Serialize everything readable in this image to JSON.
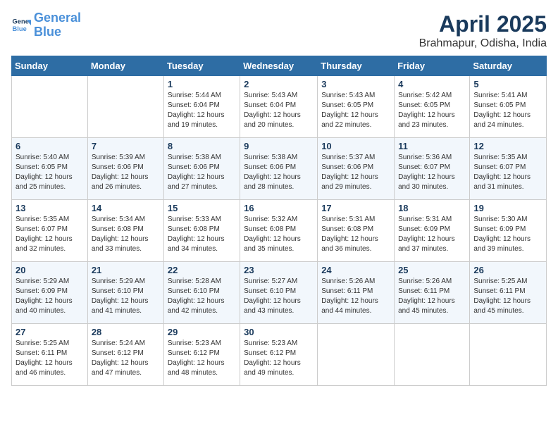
{
  "header": {
    "logo_line1": "General",
    "logo_line2": "Blue",
    "title": "April 2025",
    "subtitle": "Brahmapur, Odisha, India"
  },
  "weekdays": [
    "Sunday",
    "Monday",
    "Tuesday",
    "Wednesday",
    "Thursday",
    "Friday",
    "Saturday"
  ],
  "weeks": [
    [
      {
        "day": "",
        "sunrise": "",
        "sunset": "",
        "daylight": ""
      },
      {
        "day": "",
        "sunrise": "",
        "sunset": "",
        "daylight": ""
      },
      {
        "day": "1",
        "sunrise": "Sunrise: 5:44 AM",
        "sunset": "Sunset: 6:04 PM",
        "daylight": "Daylight: 12 hours and 19 minutes."
      },
      {
        "day": "2",
        "sunrise": "Sunrise: 5:43 AM",
        "sunset": "Sunset: 6:04 PM",
        "daylight": "Daylight: 12 hours and 20 minutes."
      },
      {
        "day": "3",
        "sunrise": "Sunrise: 5:43 AM",
        "sunset": "Sunset: 6:05 PM",
        "daylight": "Daylight: 12 hours and 22 minutes."
      },
      {
        "day": "4",
        "sunrise": "Sunrise: 5:42 AM",
        "sunset": "Sunset: 6:05 PM",
        "daylight": "Daylight: 12 hours and 23 minutes."
      },
      {
        "day": "5",
        "sunrise": "Sunrise: 5:41 AM",
        "sunset": "Sunset: 6:05 PM",
        "daylight": "Daylight: 12 hours and 24 minutes."
      }
    ],
    [
      {
        "day": "6",
        "sunrise": "Sunrise: 5:40 AM",
        "sunset": "Sunset: 6:05 PM",
        "daylight": "Daylight: 12 hours and 25 minutes."
      },
      {
        "day": "7",
        "sunrise": "Sunrise: 5:39 AM",
        "sunset": "Sunset: 6:06 PM",
        "daylight": "Daylight: 12 hours and 26 minutes."
      },
      {
        "day": "8",
        "sunrise": "Sunrise: 5:38 AM",
        "sunset": "Sunset: 6:06 PM",
        "daylight": "Daylight: 12 hours and 27 minutes."
      },
      {
        "day": "9",
        "sunrise": "Sunrise: 5:38 AM",
        "sunset": "Sunset: 6:06 PM",
        "daylight": "Daylight: 12 hours and 28 minutes."
      },
      {
        "day": "10",
        "sunrise": "Sunrise: 5:37 AM",
        "sunset": "Sunset: 6:06 PM",
        "daylight": "Daylight: 12 hours and 29 minutes."
      },
      {
        "day": "11",
        "sunrise": "Sunrise: 5:36 AM",
        "sunset": "Sunset: 6:07 PM",
        "daylight": "Daylight: 12 hours and 30 minutes."
      },
      {
        "day": "12",
        "sunrise": "Sunrise: 5:35 AM",
        "sunset": "Sunset: 6:07 PM",
        "daylight": "Daylight: 12 hours and 31 minutes."
      }
    ],
    [
      {
        "day": "13",
        "sunrise": "Sunrise: 5:35 AM",
        "sunset": "Sunset: 6:07 PM",
        "daylight": "Daylight: 12 hours and 32 minutes."
      },
      {
        "day": "14",
        "sunrise": "Sunrise: 5:34 AM",
        "sunset": "Sunset: 6:08 PM",
        "daylight": "Daylight: 12 hours and 33 minutes."
      },
      {
        "day": "15",
        "sunrise": "Sunrise: 5:33 AM",
        "sunset": "Sunset: 6:08 PM",
        "daylight": "Daylight: 12 hours and 34 minutes."
      },
      {
        "day": "16",
        "sunrise": "Sunrise: 5:32 AM",
        "sunset": "Sunset: 6:08 PM",
        "daylight": "Daylight: 12 hours and 35 minutes."
      },
      {
        "day": "17",
        "sunrise": "Sunrise: 5:31 AM",
        "sunset": "Sunset: 6:08 PM",
        "daylight": "Daylight: 12 hours and 36 minutes."
      },
      {
        "day": "18",
        "sunrise": "Sunrise: 5:31 AM",
        "sunset": "Sunset: 6:09 PM",
        "daylight": "Daylight: 12 hours and 37 minutes."
      },
      {
        "day": "19",
        "sunrise": "Sunrise: 5:30 AM",
        "sunset": "Sunset: 6:09 PM",
        "daylight": "Daylight: 12 hours and 39 minutes."
      }
    ],
    [
      {
        "day": "20",
        "sunrise": "Sunrise: 5:29 AM",
        "sunset": "Sunset: 6:09 PM",
        "daylight": "Daylight: 12 hours and 40 minutes."
      },
      {
        "day": "21",
        "sunrise": "Sunrise: 5:29 AM",
        "sunset": "Sunset: 6:10 PM",
        "daylight": "Daylight: 12 hours and 41 minutes."
      },
      {
        "day": "22",
        "sunrise": "Sunrise: 5:28 AM",
        "sunset": "Sunset: 6:10 PM",
        "daylight": "Daylight: 12 hours and 42 minutes."
      },
      {
        "day": "23",
        "sunrise": "Sunrise: 5:27 AM",
        "sunset": "Sunset: 6:10 PM",
        "daylight": "Daylight: 12 hours and 43 minutes."
      },
      {
        "day": "24",
        "sunrise": "Sunrise: 5:26 AM",
        "sunset": "Sunset: 6:11 PM",
        "daylight": "Daylight: 12 hours and 44 minutes."
      },
      {
        "day": "25",
        "sunrise": "Sunrise: 5:26 AM",
        "sunset": "Sunset: 6:11 PM",
        "daylight": "Daylight: 12 hours and 45 minutes."
      },
      {
        "day": "26",
        "sunrise": "Sunrise: 5:25 AM",
        "sunset": "Sunset: 6:11 PM",
        "daylight": "Daylight: 12 hours and 45 minutes."
      }
    ],
    [
      {
        "day": "27",
        "sunrise": "Sunrise: 5:25 AM",
        "sunset": "Sunset: 6:11 PM",
        "daylight": "Daylight: 12 hours and 46 minutes."
      },
      {
        "day": "28",
        "sunrise": "Sunrise: 5:24 AM",
        "sunset": "Sunset: 6:12 PM",
        "daylight": "Daylight: 12 hours and 47 minutes."
      },
      {
        "day": "29",
        "sunrise": "Sunrise: 5:23 AM",
        "sunset": "Sunset: 6:12 PM",
        "daylight": "Daylight: 12 hours and 48 minutes."
      },
      {
        "day": "30",
        "sunrise": "Sunrise: 5:23 AM",
        "sunset": "Sunset: 6:12 PM",
        "daylight": "Daylight: 12 hours and 49 minutes."
      },
      {
        "day": "",
        "sunrise": "",
        "sunset": "",
        "daylight": ""
      },
      {
        "day": "",
        "sunrise": "",
        "sunset": "",
        "daylight": ""
      },
      {
        "day": "",
        "sunrise": "",
        "sunset": "",
        "daylight": ""
      }
    ]
  ]
}
